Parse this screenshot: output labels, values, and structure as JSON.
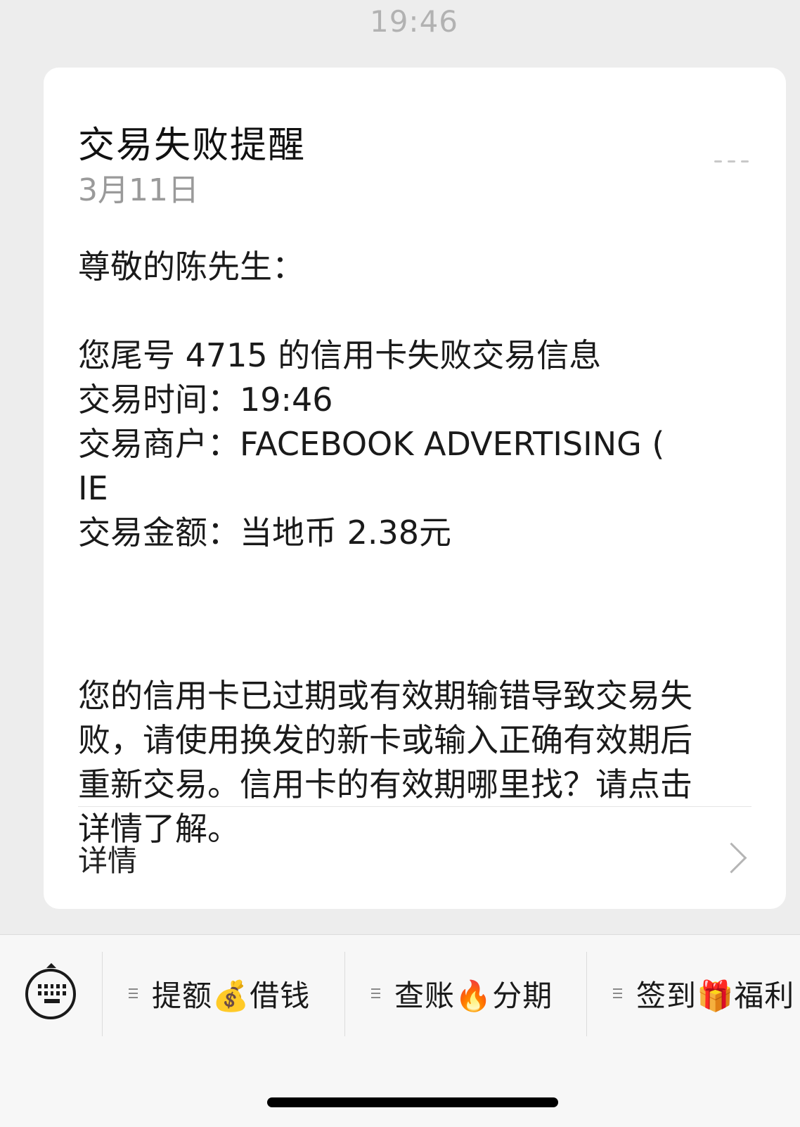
{
  "header": {
    "timestamp": "19:46"
  },
  "card": {
    "title": "交易失败提醒",
    "date": "3月11日",
    "greeting": "尊敬的陈先生：",
    "info_lines": [
      "您尾号 4715 的信用卡失败交易信息",
      "交易时间：19:46",
      "交易商户：FACEBOOK ADVERTISING (",
      "IE",
      "交易金额：当地币 2.38元"
    ],
    "paragraph_lines": [
      "您的信用卡已过期或有效期输错导致交易失",
      "败，请使用换发的新卡或输入正确有效期后",
      "重新交易。信用卡的有效期哪里找？请点击",
      "详情了解。"
    ],
    "details_label": "详情"
  },
  "bottom_menu": {
    "items": [
      {
        "label": "提额💰借钱"
      },
      {
        "label": "查账🔥分期"
      },
      {
        "label": "签到🎁福利"
      }
    ]
  },
  "icons": {
    "more": "more-dots-icon",
    "chevron": "chevron-right-icon",
    "keyboard": "keyboard-icon",
    "menu": "menu-lines-icon"
  },
  "colors": {
    "background": "#ededed",
    "card": "#ffffff",
    "muted_text": "#9a9a9a"
  }
}
